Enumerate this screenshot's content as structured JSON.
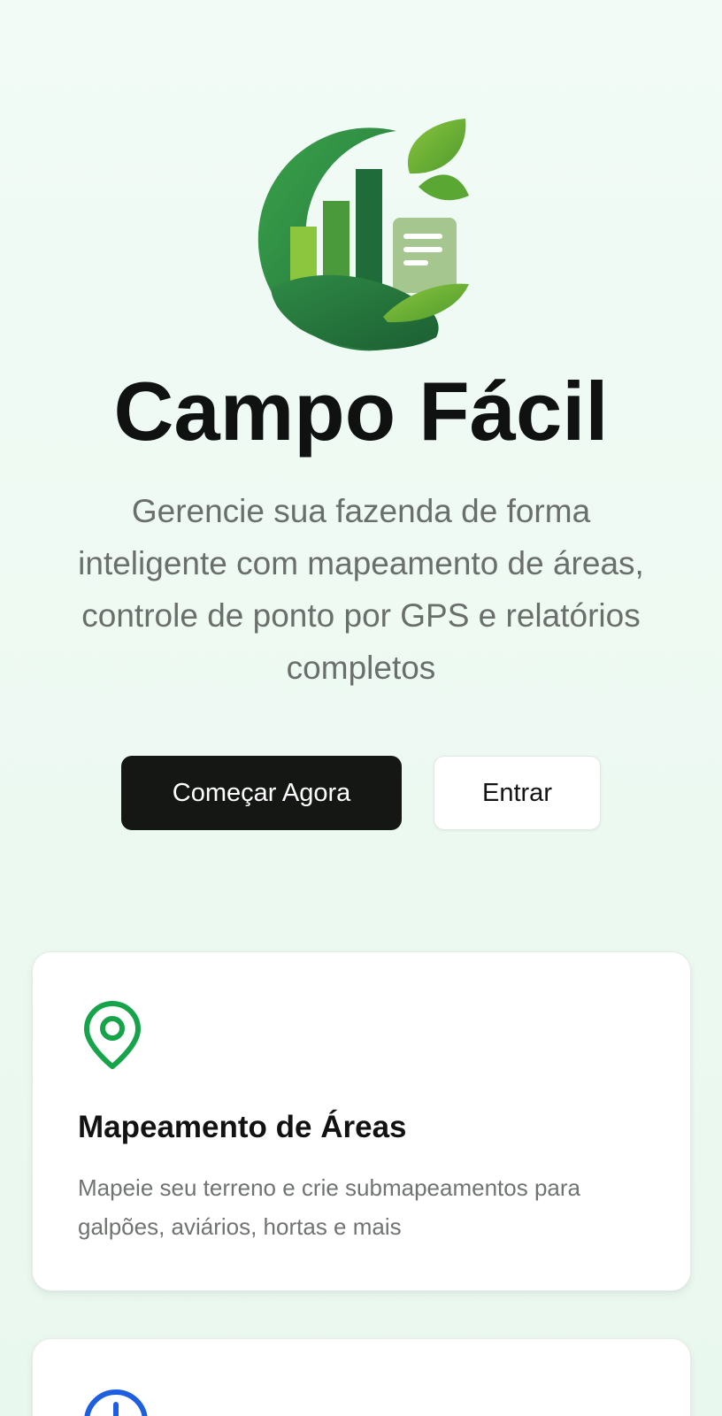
{
  "app": {
    "title": "Campo Fácil",
    "subtitle": "Gerencie sua fazenda de forma inteligente com mapeamento de áreas, controle de ponto por GPS e relatórios completos",
    "logo_icon": "farm-growth-chart-logo-icon"
  },
  "actions": {
    "primary_label": "Começar Agora",
    "secondary_label": "Entrar"
  },
  "features": [
    {
      "icon": "map-pin-icon",
      "icon_color": "#16a34a",
      "title": "Mapeamento de Áreas",
      "description": "Mapeie seu terreno e crie submapeamentos para galpões, aviários, hortas e mais"
    },
    {
      "icon": "clock-icon",
      "icon_color": "#1d5fe0"
    }
  ],
  "colors": {
    "background": "#eef9f2",
    "primary_button": "#151715",
    "accent_green": "#16a34a",
    "accent_blue": "#1d5fe0"
  }
}
